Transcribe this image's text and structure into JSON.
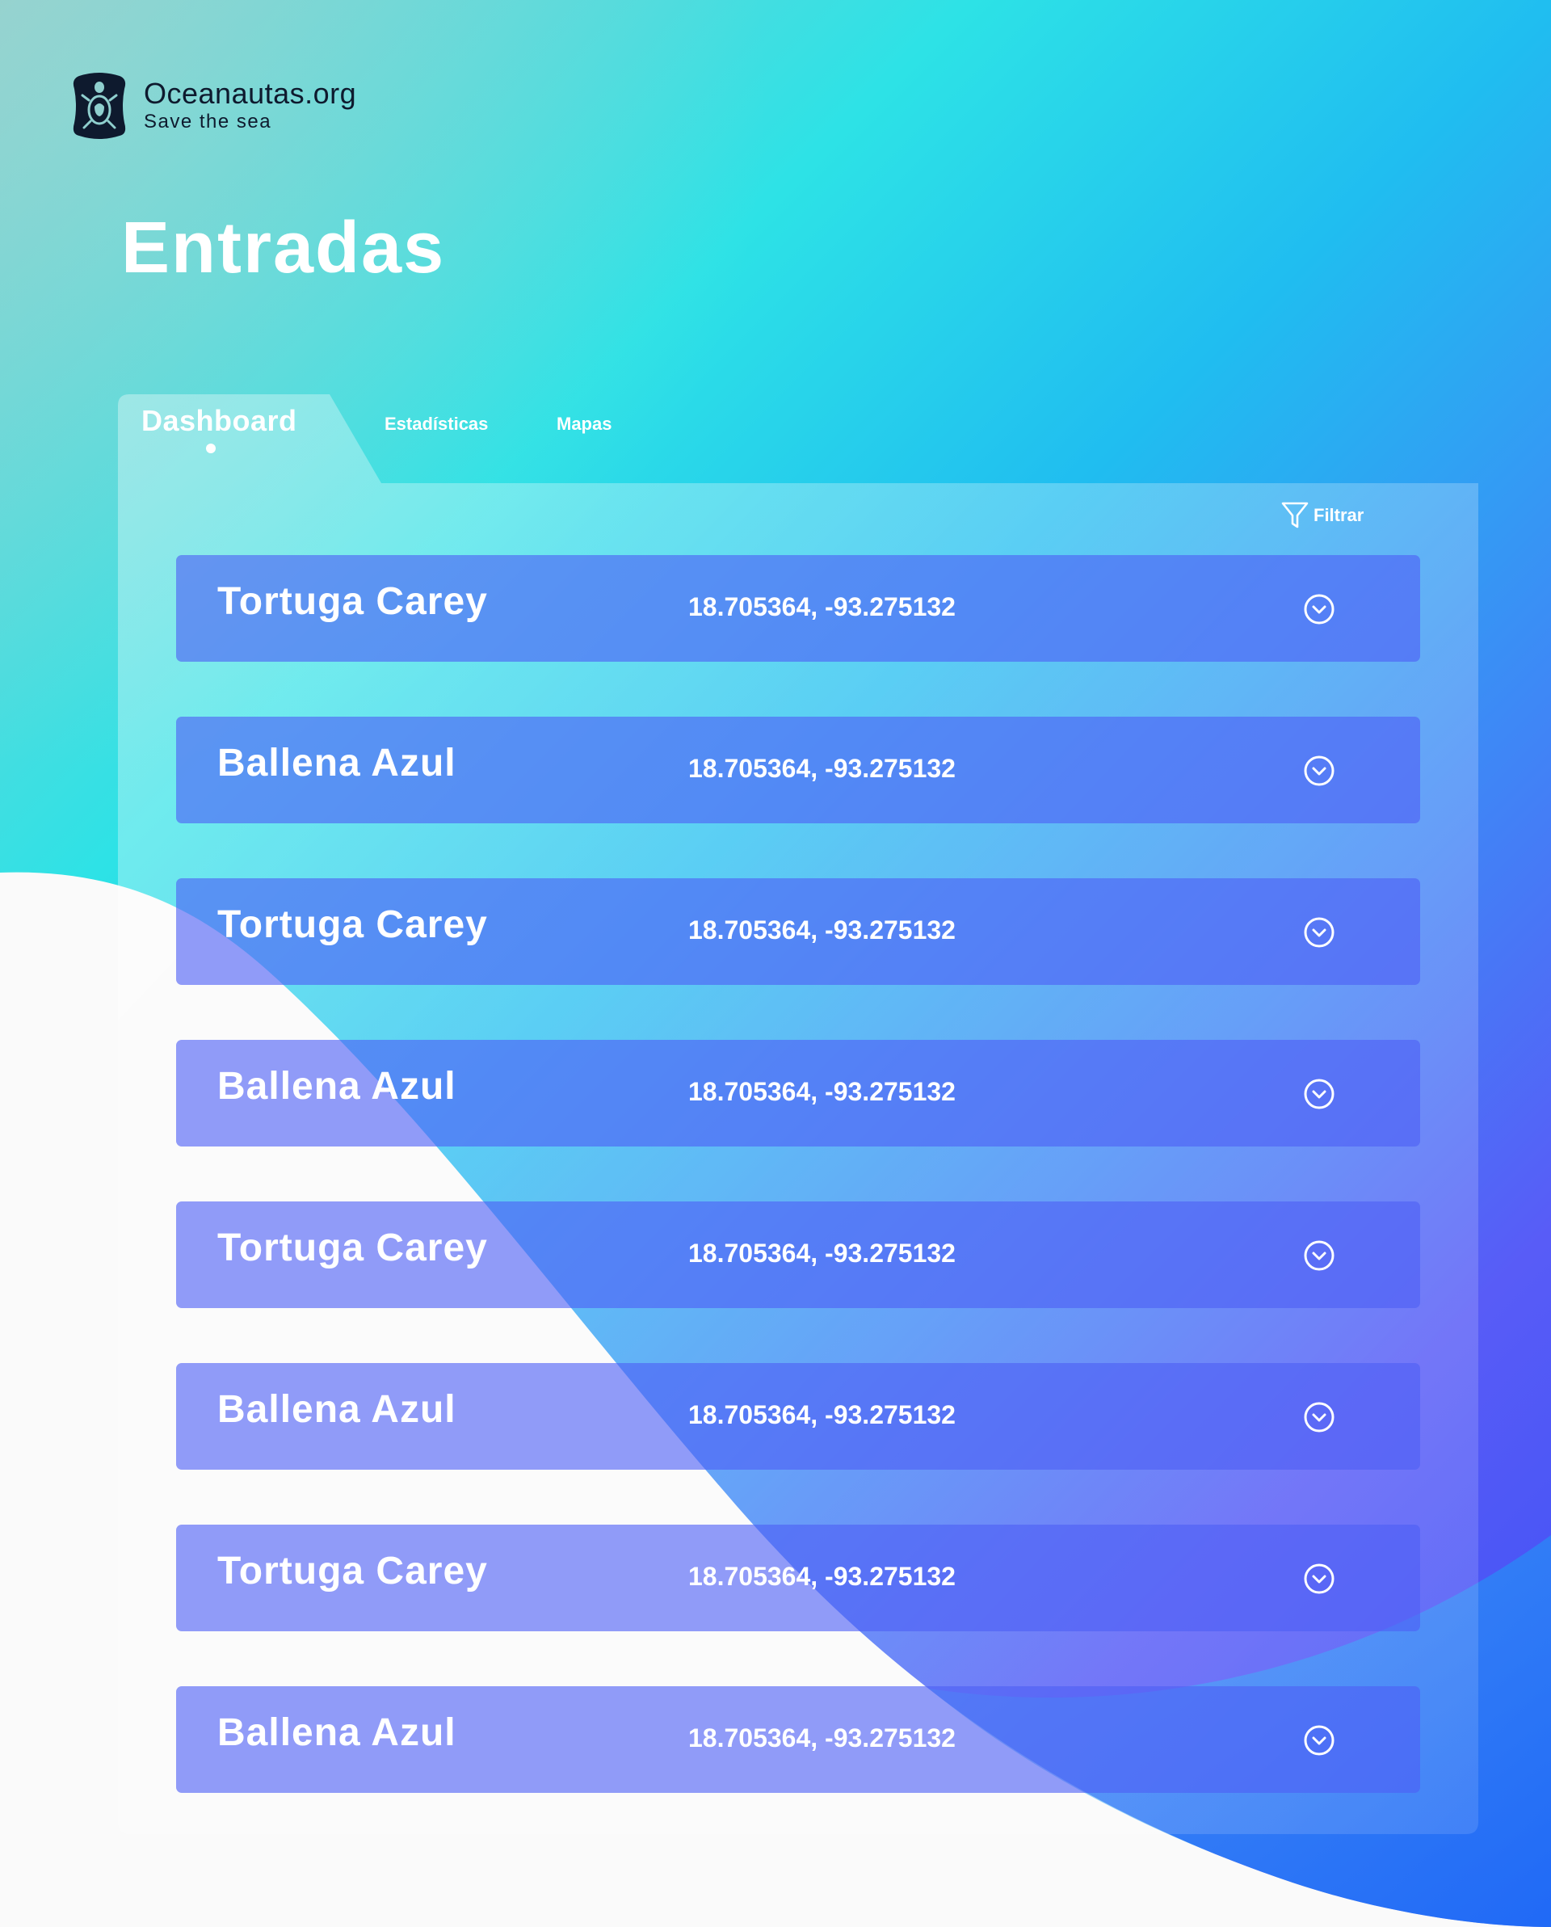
{
  "brand": {
    "name": "Oceanautas.org",
    "tagline": "Save the sea"
  },
  "page": {
    "title": "Entradas"
  },
  "tabs": [
    {
      "label": "Dashboard",
      "active": true
    },
    {
      "label": "Estadísticas",
      "active": false
    },
    {
      "label": "Mapas",
      "active": false
    }
  ],
  "filter": {
    "label": "Filtrar",
    "icon": "filter-icon"
  },
  "entries": [
    {
      "name": "Tortuga Carey",
      "coords": "18.705364, -93.275132",
      "icon": "chevron-down-circle-icon"
    },
    {
      "name": "Ballena Azul",
      "coords": "18.705364, -93.275132",
      "icon": "chevron-down-circle-icon"
    },
    {
      "name": "Tortuga Carey",
      "coords": "18.705364, -93.275132",
      "icon": "chevron-down-circle-icon"
    },
    {
      "name": "Ballena Azul",
      "coords": "18.705364, -93.275132",
      "icon": "chevron-down-circle-icon"
    },
    {
      "name": "Tortuga Carey",
      "coords": "18.705364, -93.275132",
      "icon": "chevron-down-circle-icon"
    },
    {
      "name": "Ballena Azul",
      "coords": "18.705364, -93.275132",
      "icon": "chevron-down-circle-icon"
    },
    {
      "name": "Tortuga Carey",
      "coords": "18.705364, -93.275132",
      "icon": "chevron-down-circle-icon"
    },
    {
      "name": "Ballena Azul",
      "coords": "18.705364, -93.275132",
      "icon": "chevron-down-circle-icon"
    }
  ],
  "colors": {
    "row_fill": "#4e5ff6",
    "text": "#ffffff",
    "brand_text": "#0e1a2e",
    "panel_white": "#fafafa"
  }
}
